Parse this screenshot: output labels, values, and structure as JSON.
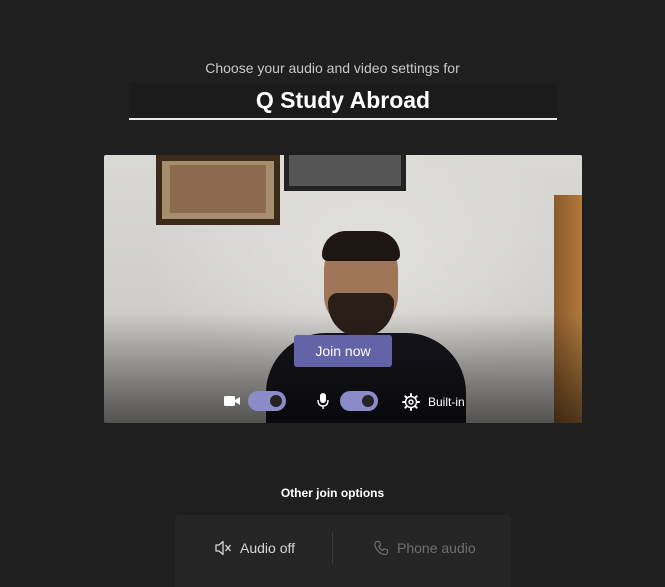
{
  "header": {
    "subtitle": "Choose your audio and video settings for",
    "meeting_name": "Q Study Abroad"
  },
  "preview": {
    "join_label": "Join now",
    "camera_toggle": {
      "icon": "camera-icon",
      "on": true
    },
    "mic_toggle": {
      "icon": "microphone-icon",
      "on": true
    },
    "device": {
      "icon": "gear-icon",
      "label": "Built-in"
    }
  },
  "other_options": {
    "title": "Other join options",
    "audio_off": {
      "icon": "speaker-off-icon",
      "label": "Audio off"
    },
    "phone_audio": {
      "icon": "phone-icon",
      "label": "Phone audio"
    }
  },
  "colors": {
    "background": "#1f1f1f",
    "accent": "#6264a7",
    "toggle_on": "#8b8cc7",
    "panel": "#252525"
  }
}
